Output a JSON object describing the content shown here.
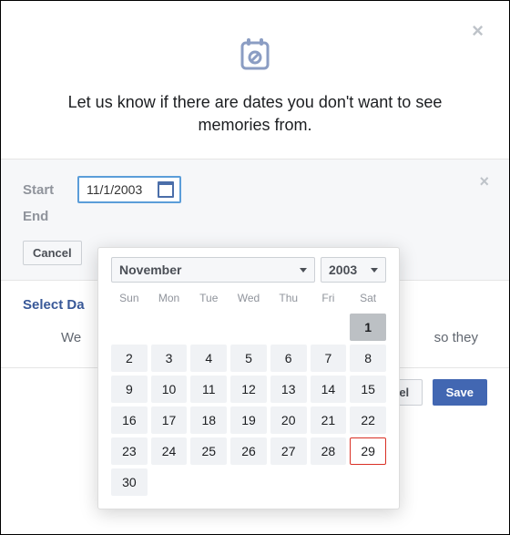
{
  "modal": {
    "heading": "Let us know if there are dates you don't want to see memories from."
  },
  "range": {
    "start_label": "Start",
    "end_label": "End",
    "start_value": "11/1/2003",
    "cancel_label": "Cancel"
  },
  "select_dates_label": "Select Da",
  "subtext": {
    "left_fragment": "We",
    "right_fragment": "so they"
  },
  "footer": {
    "cancel_label": "ancel",
    "save_label": "Save"
  },
  "calendar": {
    "month_label": "November",
    "year_label": "2003",
    "dow": [
      "Sun",
      "Mon",
      "Tue",
      "Wed",
      "Thu",
      "Fri",
      "Sat"
    ],
    "leading_blanks": 6,
    "days_in_month": 30,
    "selected_day": 1,
    "highlighted_day": 29
  }
}
